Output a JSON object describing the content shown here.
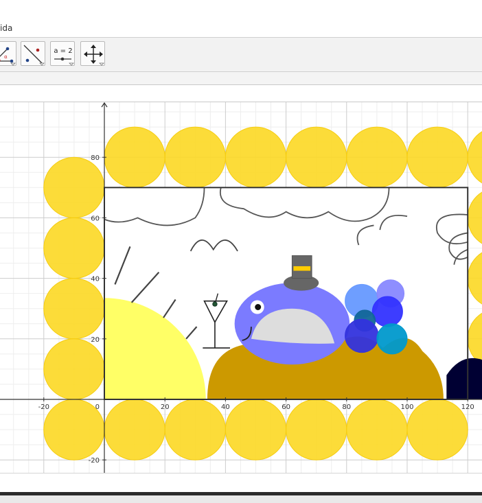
{
  "menu": {
    "item_label": "ida"
  },
  "toolbar": {
    "tools": [
      {
        "name": "angle-tool",
        "icon": "angle-icon"
      },
      {
        "name": "line-tool",
        "icon": "line-icon"
      },
      {
        "name": "slider-tool",
        "icon": "slider-icon",
        "label": "a = 2"
      },
      {
        "name": "move-view-tool",
        "icon": "move-arrows-icon"
      }
    ]
  },
  "colors": {
    "border_circles": "#fcd824",
    "sun": "#ffff66",
    "sun_rays": "#444444",
    "hill": "#cc9900",
    "whale": "#7b7bff",
    "whale_belly": "#dddddd",
    "hat": "#666666",
    "hat_band": "#ffcc00",
    "dark_blob": "#000033",
    "grid_major": "#cccccc",
    "grid_minor": "#eeeeee",
    "axes": "#333333"
  },
  "chart_data": {
    "type": "scatter",
    "xlim": [
      -35,
      125
    ],
    "ylim": [
      -25,
      97
    ],
    "grid": true,
    "x_ticks": [
      -20,
      0,
      20,
      40,
      60,
      80,
      100,
      120
    ],
    "y_ticks": [
      -20,
      20,
      40,
      60,
      80
    ],
    "x_tick_labels": [
      "-20",
      "0",
      "20",
      "40",
      "60",
      "80",
      "100",
      "120"
    ],
    "y_tick_labels": [
      "-20",
      "20",
      "40",
      "60",
      "80"
    ],
    "origin_label": "0",
    "frame": {
      "x": [
        0,
        120
      ],
      "y": [
        0,
        70
      ]
    },
    "border_circles": {
      "radius": 10,
      "centers": [
        [
          10,
          80
        ],
        [
          30,
          80
        ],
        [
          50,
          80
        ],
        [
          70,
          80
        ],
        [
          90,
          80
        ],
        [
          110,
          80
        ],
        [
          130,
          80
        ],
        [
          -10,
          70
        ],
        [
          -10,
          50
        ],
        [
          -10,
          30
        ],
        [
          -10,
          10
        ],
        [
          -10,
          -10
        ],
        [
          10,
          -10
        ],
        [
          30,
          -10
        ],
        [
          50,
          -10
        ],
        [
          70,
          -10
        ],
        [
          90,
          -10
        ],
        [
          110,
          -10
        ],
        [
          130,
          60
        ],
        [
          130,
          40
        ],
        [
          130,
          20
        ]
      ]
    },
    "sun": {
      "center": [
        0,
        0
      ],
      "radius": 33.5
    },
    "sun_rays": [
      [
        [
          3.5,
          38
        ],
        [
          8.5,
          50.5
        ]
      ],
      [
        [
          9,
          32
        ],
        [
          18,
          42
        ]
      ],
      [
        [
          19.5,
          27
        ],
        [
          23.5,
          33
        ]
      ],
      [
        [
          27,
          20
        ],
        [
          30.5,
          24
        ]
      ]
    ],
    "whale": {
      "center": [
        62,
        25
      ],
      "rx": 19,
      "ry": 13.5,
      "eye": [
        50.5,
        30.5
      ]
    },
    "hat": {
      "brim": [
        65,
        38.5
      ],
      "top_x": [
        62,
        68.5
      ],
      "top_y": [
        40,
        47.5
      ]
    },
    "glass": {
      "cup_top": [
        [
          33,
          32.5
        ],
        [
          40.5,
          32.5
        ]
      ],
      "stem_bottom": [
        36.5,
        17
      ],
      "base": [
        [
          32.5,
          17
        ],
        [
          41.5,
          17
        ]
      ],
      "olive": [
        36.5,
        31.5
      ]
    },
    "blue_circles": [
      {
        "c": [
          85,
          32.5
        ],
        "r": 5.5,
        "color": "#6699ff"
      },
      {
        "c": [
          94.5,
          35
        ],
        "r": 4.5,
        "color": "#8888ff"
      },
      {
        "c": [
          93.5,
          29
        ],
        "r": 5,
        "color": "#3333ff"
      },
      {
        "c": [
          86,
          26
        ],
        "r": 3.5,
        "color": "#116699"
      },
      {
        "c": [
          85,
          21
        ],
        "r": 5.5,
        "color": "#3333dd"
      },
      {
        "c": [
          95,
          20
        ],
        "r": 5,
        "color": "#0099cc"
      }
    ]
  }
}
